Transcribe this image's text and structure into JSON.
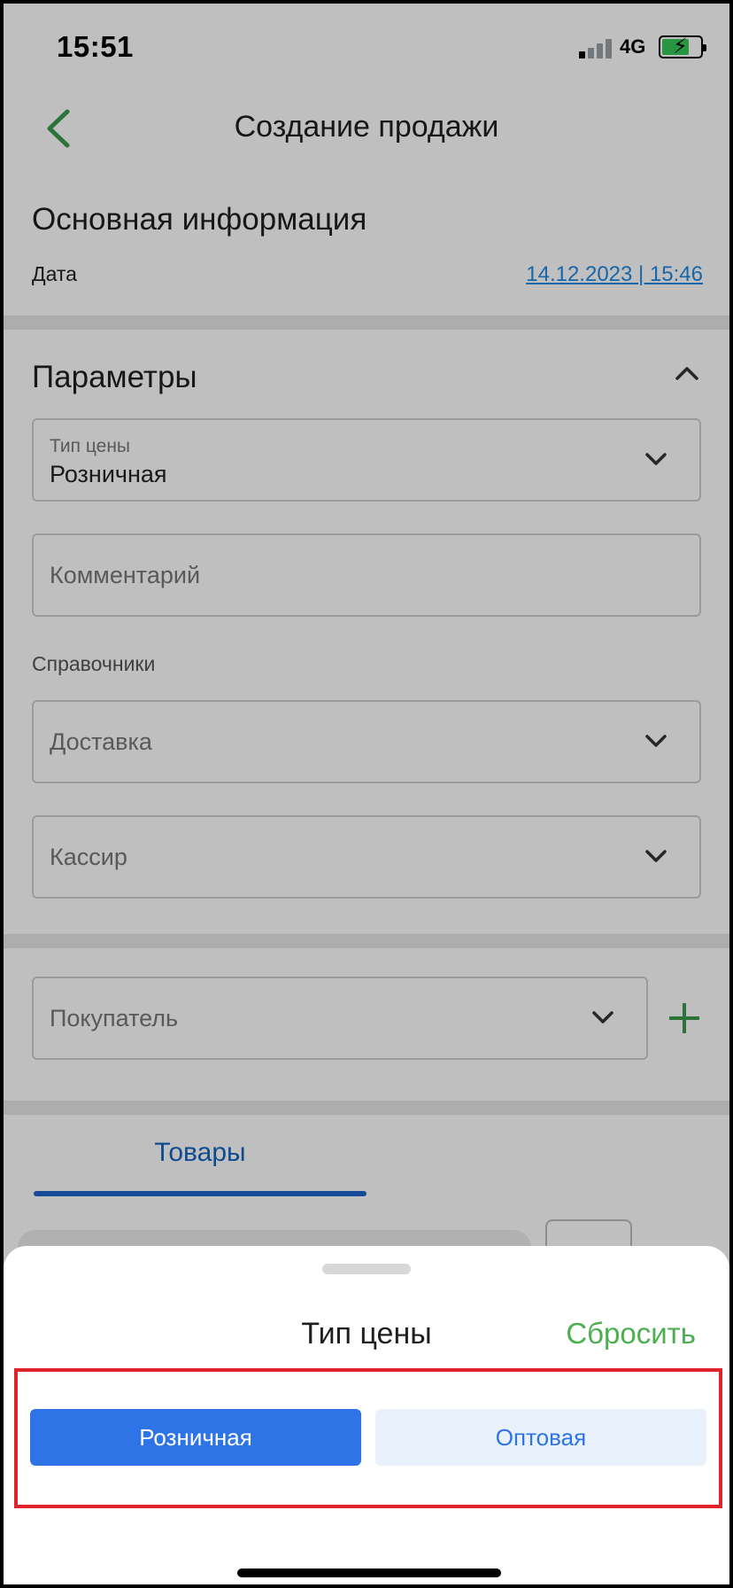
{
  "status": {
    "time": "15:51",
    "network": "4G"
  },
  "header": {
    "title": "Создание продажи"
  },
  "main_info": {
    "title": "Основная информация",
    "date_label": "Дата",
    "date_value": "14.12.2023 | 15:46"
  },
  "params": {
    "title": "Параметры",
    "price_type_label": "Тип цены",
    "price_type_value": "Розничная",
    "comment_placeholder": "Комментарий",
    "refs_label": "Справочники",
    "delivery_placeholder": "Доставка",
    "cashier_placeholder": "Кассир"
  },
  "buyer": {
    "placeholder": "Покупатель"
  },
  "tabs": {
    "goods": "Товары"
  },
  "sheet": {
    "title": "Тип цены",
    "reset": "Сбросить",
    "options": [
      "Розничная",
      "Оптовая"
    ]
  },
  "colors": {
    "accent_blue": "#2f74e6",
    "accent_green": "#4caf50",
    "highlight_red": "#e0242b"
  }
}
